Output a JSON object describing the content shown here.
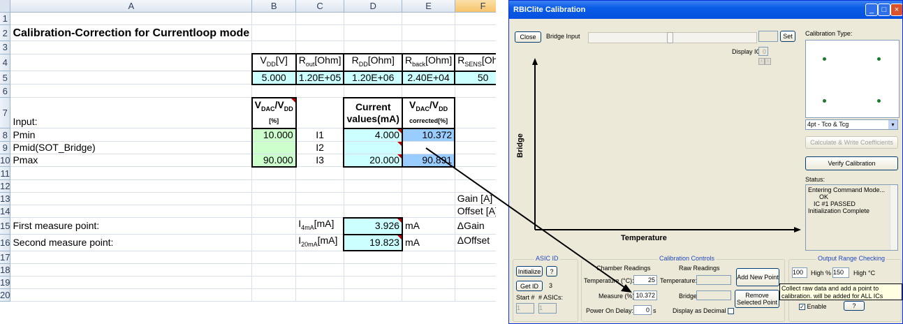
{
  "sheet": {
    "col_headers": [
      "A",
      "B",
      "C",
      "D",
      "E",
      "F"
    ],
    "row_numbers": [
      "1",
      "2",
      "3",
      "4",
      "5",
      "6",
      "7",
      "8",
      "9",
      "10",
      "11",
      "12",
      "13",
      "14",
      "15",
      "16",
      "17",
      "18",
      "19",
      "20"
    ],
    "title": "Calibration-Correction for Currentloop mode",
    "params": {
      "h_vdd": "V",
      "h_vdd_sub": "DD",
      "h_vdd_unit": "[V]",
      "h_rout": "R",
      "h_rout_sub": "out",
      "h_rout_unit": "[Ohm]",
      "h_rdd": "R",
      "h_rdd_sub": "DD",
      "h_rdd_unit": "[Ohm]",
      "h_rback": "R",
      "h_rback_sub": "back",
      "h_rback_unit": "[Ohm]",
      "h_rsens": "R",
      "h_rsens_sub": "SENS",
      "h_rsens_unit": "[Ohm]",
      "vdd": "5.000",
      "rout": "1.20E+05",
      "rdd": "1.20E+06",
      "rback": "2.40E+04",
      "rsens": "50"
    },
    "input_label": "Input:",
    "vdac_head": {
      "v1": "V",
      "s1": "DAC",
      "slash": "/V",
      "s2": "DD",
      "unit": "[%]"
    },
    "current_head": {
      "l1": "Current",
      "l2": "values(mA)"
    },
    "corr_head": {
      "v1": "V",
      "s1": "DAC",
      "slash": "/V",
      "s2": "DD",
      "unit": "corrected[%]"
    },
    "rows": {
      "pmin": {
        "label": "Pmin",
        "vdac": "10.000",
        "i": "I1",
        "current": "4.000",
        "corrected": "10.372"
      },
      "pmid": {
        "label": "Pmid(SOT_Bridge)",
        "i": "I2"
      },
      "pmax": {
        "label": "Pmax",
        "vdac": "90.000",
        "i": "I3",
        "current": "20.000",
        "corrected": "90.891"
      }
    },
    "gain": "Gain [A]",
    "offset": "Offset [A]",
    "first": {
      "label": "First measure point:",
      "i": "I",
      "isub": "4mA",
      "iunit": "[mA]",
      "value": "3.926",
      "unit": "mA",
      "delta": "ΔGain"
    },
    "second": {
      "label": "Second measure point:",
      "i": "I",
      "isub": "20mA",
      "iunit": "[mA]",
      "value": "19.823",
      "unit": "mA",
      "delta": "ΔOffset"
    }
  },
  "dialog": {
    "title": "RBIClite Calibration",
    "close": "Close",
    "bridge_input": "Bridge Input",
    "set": "Set",
    "display_ic": "Display IC #:",
    "display_ic_value": "0",
    "calibration_type": "Calibration Type:",
    "cal_type_selected": "4pt - Tco & Tcg",
    "calc_write": "Calculate & Write Coefficients",
    "verify": "Verify Calibration",
    "status_label": "Status:",
    "status_lines": [
      "Entering Command Mode...",
      "OK",
      "IC #1 PASSED",
      "Initialization Complete"
    ],
    "y_label": "Bridge",
    "x_label": "Temperature",
    "asic": {
      "title": "ASIC ID",
      "initialize": "Initialize",
      "help": "?",
      "get_id": "Get ID",
      "count": "3",
      "start": "Start #",
      "asics": "# ASICs:",
      "start_val": "1",
      "asics_val": "1"
    },
    "cal_controls": {
      "title": "Calibration Controls",
      "chamber": "Chamber Readings",
      "raw": "Raw Readings",
      "temp_label": "Temperature (°C):",
      "temp_value": "25",
      "raw_temp": "Temperature:",
      "measure_label": "Measure (%):",
      "measure_value": "10.372",
      "bridge": "Bridge:",
      "power_on": "Power On Delay:",
      "power_value": "0",
      "power_unit": "s",
      "display_decimal": "Display as Decimal",
      "add": "Add New Point",
      "remove": "Remove Selected Point"
    },
    "output_range": {
      "title": "Output Range Checking",
      "high_pct_val": "100",
      "high_pct": "High %",
      "high_c_val": "150",
      "high_c": "High °C",
      "enable": "Enable",
      "help": "?"
    },
    "tooltip": "Collect raw data and add a point to calibration. will be added for ALL ICs"
  }
}
